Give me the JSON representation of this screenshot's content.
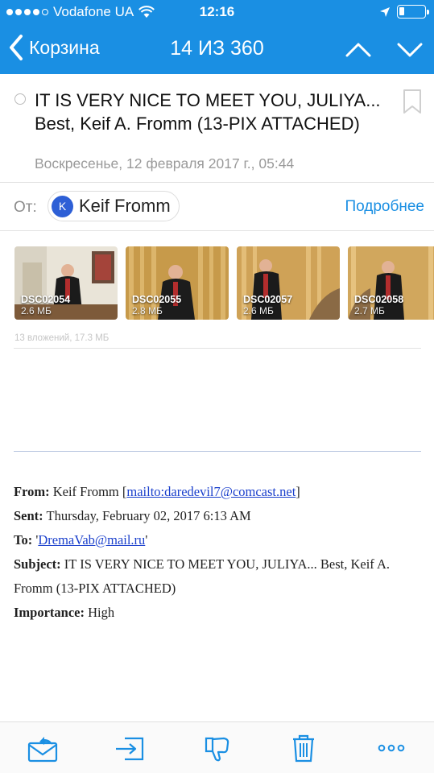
{
  "status_bar": {
    "carrier": "Vodafone UA",
    "time": "12:16"
  },
  "nav": {
    "back_label": "Корзина",
    "position": "14 ИЗ 360"
  },
  "message": {
    "subject": "IT IS VERY NICE TO MEET YOU, JULIYA...  Best, Keif A. Fromm (13-PIX ATTACHED)",
    "date": "Воскресенье, 12 февраля 2017 г., 05:44",
    "from_label": "От:",
    "sender_initial": "K",
    "sender_name": "Keif Fromm",
    "details_label": "Подробнее"
  },
  "attachments": {
    "items": [
      {
        "name": "DSC02054",
        "size": "2.6 МБ"
      },
      {
        "name": "DSC02055",
        "size": "2.8 МБ"
      },
      {
        "name": "DSC02057",
        "size": "2.6 МБ"
      },
      {
        "name": "DSC02058",
        "size": "2.7 МБ"
      }
    ],
    "summary": "13 вложений, 17.3 МБ"
  },
  "body": {
    "from_label": "From:",
    "from_name": "Keif Fromm [",
    "from_link": "mailto:daredevil7@comcast.net",
    "from_close": "]",
    "sent_label": "Sent:",
    "sent_value": "Thursday, February 02, 2017 6:13 AM",
    "to_label": "To:",
    "to_open": "'",
    "to_link": "DremaVab@mail.ru",
    "to_close": "'",
    "subject_label": "Subject:",
    "subject_value": "IT IS VERY NICE TO MEET YOU, JULIYA... Best, Keif A. Fromm (13-PIX ATTACHED)",
    "importance_label": "Importance:",
    "importance_value": "High"
  },
  "toolbar": {
    "icons": [
      "reply-icon",
      "move-icon",
      "spam-icon",
      "trash-icon",
      "more-icon"
    ]
  },
  "colors": {
    "accent": "#1a8fe3",
    "avatar": "#2d5fd6",
    "link": "#1a3fcc"
  }
}
